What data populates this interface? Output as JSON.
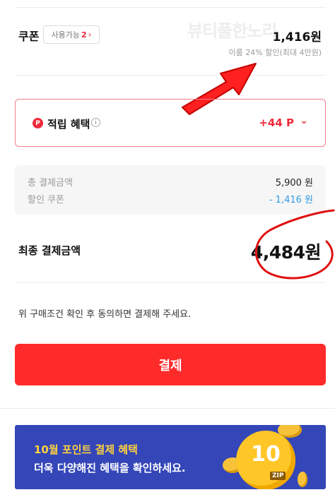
{
  "coupon": {
    "title": "쿠폰",
    "chip_label": "사용가능",
    "chip_count": "2",
    "amount": "1,416원",
    "note": "이룸 24% 할인(최대 4만원)"
  },
  "watermark": "뷰티풀한노리",
  "points": {
    "icon_letter": "P",
    "label": "적립 혜택",
    "value": "+44 P"
  },
  "summary": {
    "total_label": "총 결제금액",
    "total_value": "5,900 원",
    "discount_label": "할인 쿠폰",
    "discount_value": "- 1,416 원"
  },
  "final": {
    "label": "최종 결제금액",
    "amount": "4,484원"
  },
  "agreement_text": "위 구매조건 확인 후 동의하면 결제해 주세요.",
  "pay_button_label": "결제",
  "banner": {
    "title": "10월 포인트 결제 혜택",
    "subtitle": "더욱 다양해진 혜택을 확인하세요.",
    "coin_number": "10",
    "coin_badge": "ZIP"
  },
  "colors": {
    "accent_red": "#ff2b2b",
    "discount_blue": "#2f9be8",
    "banner_bg": "#3446b8",
    "banner_title": "#ffd23e"
  }
}
